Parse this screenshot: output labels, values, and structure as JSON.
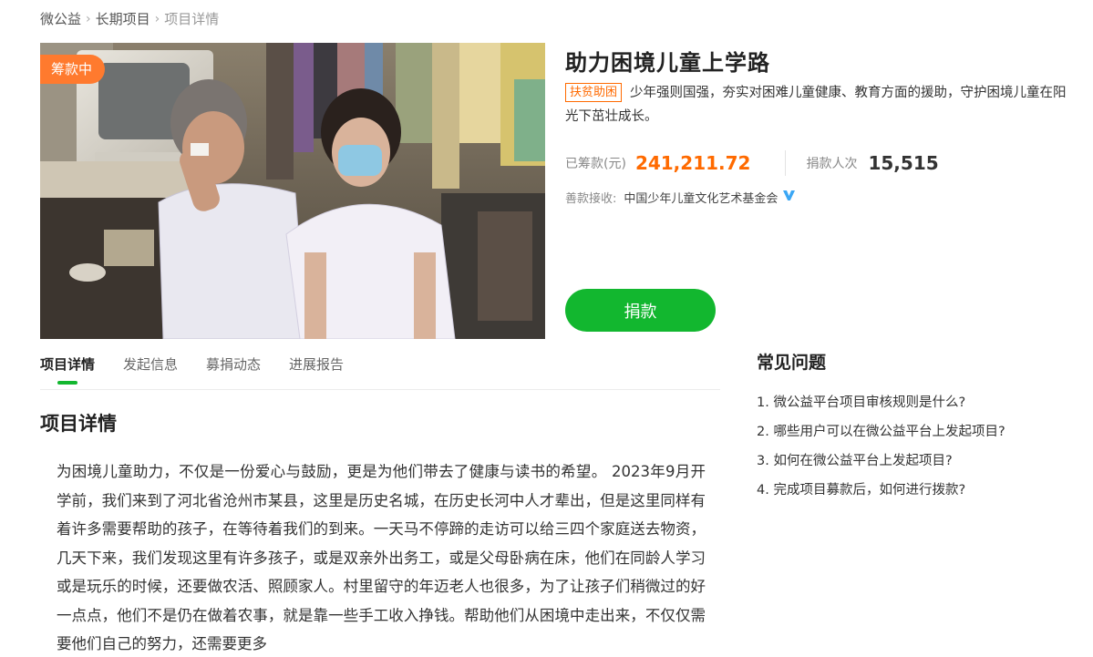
{
  "breadcrumb": {
    "items": [
      "微公益",
      "长期项目",
      "项目详情"
    ],
    "separator": "›"
  },
  "hero": {
    "status_badge": "筹款中"
  },
  "project": {
    "title": "助力困境儿童上学路",
    "tag": "扶贫助困",
    "description": "少年强则国强，夯实对困难儿童健康、教育方面的援助，守护困境儿童在阳光下茁壮成长。",
    "raised_label": "已筹款(元)",
    "raised_amount": "241,211.72",
    "donors_label": "捐款人次",
    "donors_count": "15,515",
    "receiver_label": "善款接收:",
    "receiver_org": "中国少年儿童文化艺术基金会",
    "verified_icon": "verified-v-icon",
    "donate_label": "捐款"
  },
  "tabs": [
    {
      "label": "项目详情",
      "active": true
    },
    {
      "label": "发起信息",
      "active": false
    },
    {
      "label": "募捐动态",
      "active": false
    },
    {
      "label": "进展报告",
      "active": false
    }
  ],
  "section": {
    "title": "项目详情",
    "body": "为困境儿童助力，不仅是一份爱心与鼓励，更是为他们带去了健康与读书的希望。 2023年9月开学前，我们来到了河北省沧州市某县，这里是历史名城，在历史长河中人才辈出，但是这里同样有着许多需要帮助的孩子，在等待着我们的到来。一天马不停蹄的走访可以给三四个家庭送去物资，几天下来，我们发现这里有许多孩子，或是双亲外出务工，或是父母卧病在床，他们在同龄人学习或是玩乐的时候，还要做农活、照顾家人。村里留守的年迈老人也很多，为了让孩子们稍微过的好一点点，他们不是仍在做着农事，就是靠一些手工收入挣钱。帮助他们从困境中走出来，不仅仅需要他们自己的努力，还需要更多"
  },
  "faq": {
    "title": "常见问题",
    "items": [
      "1. 微公益平台项目审核规则是什么?",
      "2. 哪些用户可以在微公益平台上发起项目?",
      "3. 如何在微公益平台上发起项目?",
      "4. 完成项目募款后，如何进行拨款?"
    ]
  },
  "colors": {
    "accent_green": "#12b72f",
    "accent_orange": "#ff6a00",
    "badge_orange": "#ff7a2e",
    "verified_blue": "#3ba7f5"
  }
}
